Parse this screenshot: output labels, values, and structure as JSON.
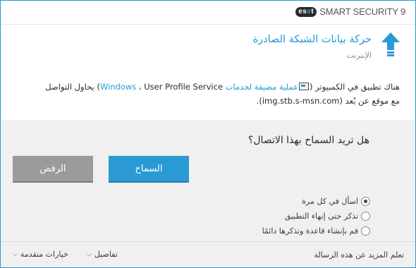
{
  "window": {
    "brand_logo_text": "eset",
    "brand_name": "SMART SECURITY 9"
  },
  "header": {
    "title": "حركة بيانات الشبكة الصادرة",
    "subtitle": "الإنترنت",
    "icon": "up-arrow-icon"
  },
  "message": {
    "part1": "هناك تطبيق في الكمبيوتر (",
    "app_link": "عملية مضيفة لخدمات Windows",
    "part2": "، User Profile Service) يحاول التواصل",
    "part3": "مع موقع عن بُعد (img.stb.s-msn.com)."
  },
  "prompt": {
    "question": "هل تريد السماح بهذا الاتصال؟",
    "allow_label": "السماح",
    "deny_label": "الرفض"
  },
  "options": [
    {
      "label": "اسأل في كل مرة",
      "checked": true
    },
    {
      "label": "تذكر حتى إنهاء التطبيق",
      "checked": false
    },
    {
      "label": "قم بإنشاء قاعدة وتذكرها دائمًا",
      "checked": false
    }
  ],
  "footer": {
    "learn_more": "تعلم المزيد عن هذه الرسالة",
    "details": "تفاصيل",
    "advanced": "خيارات متقدمة"
  },
  "colors": {
    "accent": "#1f9ad6",
    "allow_button": "#2b9ad4",
    "deny_button": "#9b9b9b",
    "panel_bg": "#f0f0f0"
  }
}
